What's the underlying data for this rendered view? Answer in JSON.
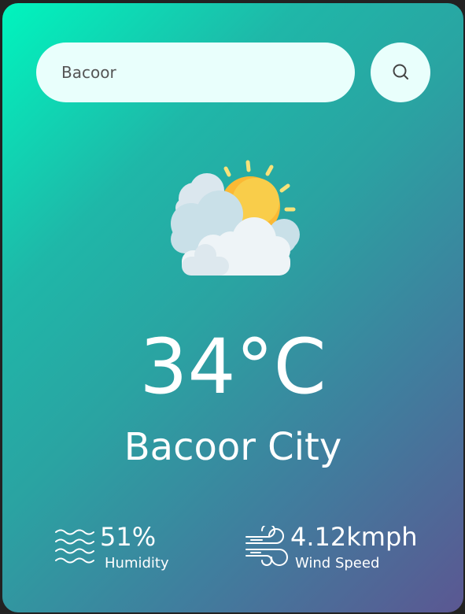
{
  "search": {
    "value": "Bacoor",
    "button_icon": "search-icon"
  },
  "weather": {
    "icon": "partly-cloudy-icon",
    "temperature": "34°C",
    "city": "Bacoor City"
  },
  "stats": {
    "humidity": {
      "value": "51%",
      "label": "Humidity",
      "icon": "humidity-icon"
    },
    "wind": {
      "value": "4.12kmph",
      "label": "Wind Speed",
      "icon": "wind-icon"
    }
  },
  "colors": {
    "gradient_start": "#00f5be",
    "gradient_end": "#5b5792",
    "input_bg": "#e9fffc",
    "text": "#ffffff"
  }
}
